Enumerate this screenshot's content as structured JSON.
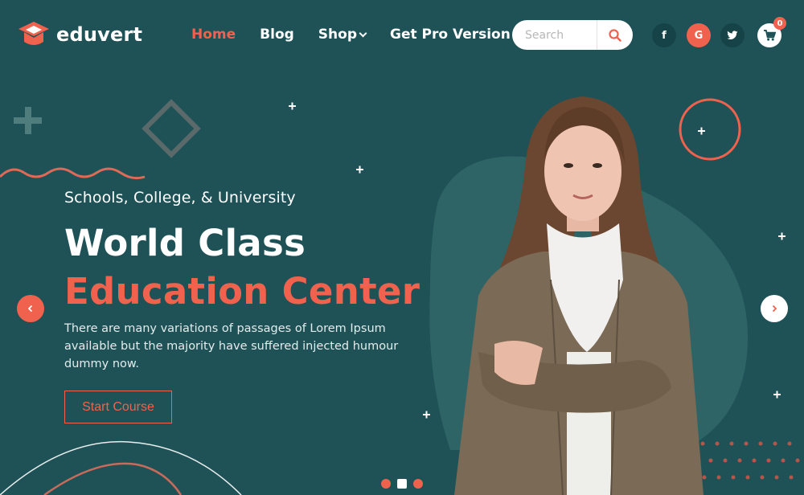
{
  "brand": {
    "name": "eduvert"
  },
  "nav": {
    "home": "Home",
    "blog": "Blog",
    "shop": "Shop",
    "pro": "Get Pro Version"
  },
  "search": {
    "placeholder": "Search"
  },
  "social": {
    "facebook": "f",
    "google": "G",
    "twitter": "twitter-icon"
  },
  "cart": {
    "count": "0"
  },
  "hero": {
    "kicker": "Schools, College, & University",
    "title_line1": "World Class",
    "title_line2": "Education Center",
    "description": "There are many variations of passages of Lorem Ipsum available but the majority have suffered injected humour dummy now.",
    "cta": "Start Course"
  },
  "slider": {
    "dots": 3,
    "active_index": 1
  },
  "colors": {
    "background": "#1e5256",
    "accent": "#f0624d",
    "white": "#ffffff"
  }
}
